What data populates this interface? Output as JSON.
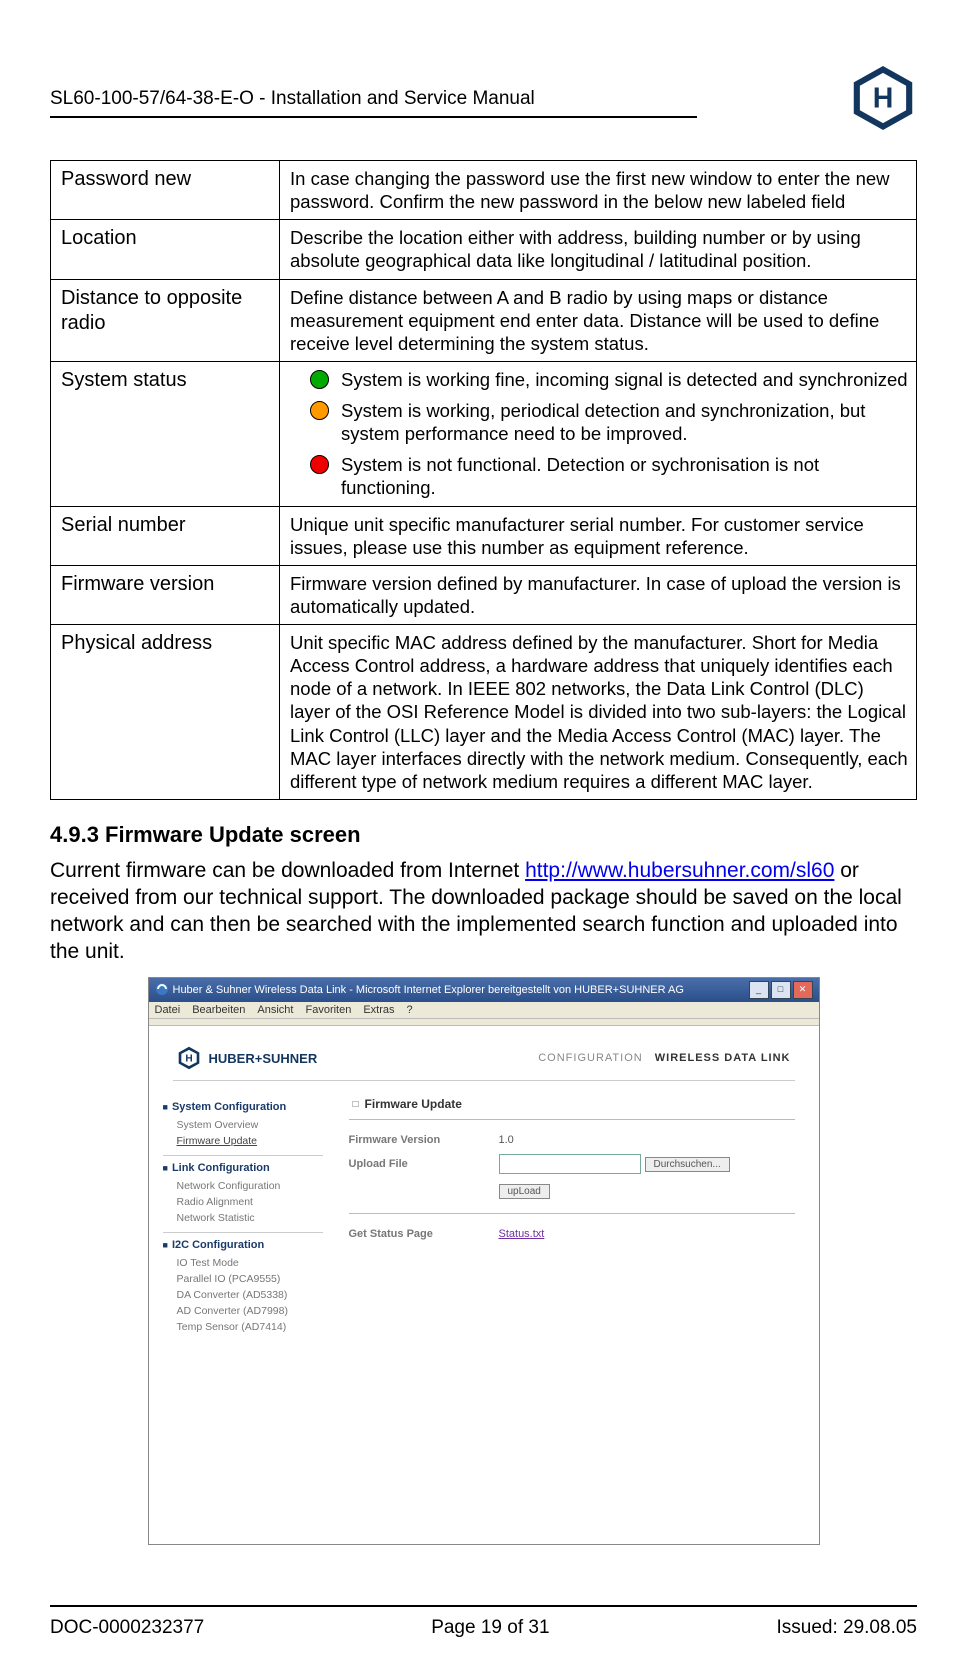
{
  "header": {
    "doc_title": "SL60-100-57/64-38-E-O  -  Installation and Service Manual"
  },
  "table": {
    "rows": [
      {
        "term": "Password new",
        "desc": "In case changing the password use the first new window to enter the new password. Confirm the new password in the below new labeled field"
      },
      {
        "term": "Location",
        "desc": "Describe the location either with address, building number or by using absolute geographical data like longitudinal / latitudinal position."
      },
      {
        "term": "Distance to opposite radio",
        "desc": "Define distance between A and B radio by using maps or distance measurement equipment end enter data. Distance will be used to define receive level determining the system status."
      },
      {
        "term": "System status",
        "status": [
          {
            "color": "green",
            "text": "System is working fine, incoming signal is detected and synchronized"
          },
          {
            "color": "orange",
            "text": "System is working, periodical detection and synchronization, but system performance need to be improved."
          },
          {
            "color": "red",
            "text": "System is not functional. Detection or sychronisation is not functioning."
          }
        ]
      },
      {
        "term": "Serial number",
        "desc": "Unique unit specific manufacturer serial number. For customer service issues, please use this number as equipment reference."
      },
      {
        "term": "Firmware version",
        "desc": "Firmware version defined by manufacturer. In case of upload the version is automatically updated."
      },
      {
        "term": "Physical address",
        "desc": "Unit specific MAC address defined by the manufacturer. Short for Media Access Control address, a hardware address that uniquely identifies each node of a network. In IEEE 802 networks, the Data Link Control (DLC) layer of the OSI Reference Model is divided into two sub-layers: the Logical Link Control (LLC) layer and the Media Access Control (MAC) layer. The MAC layer interfaces directly with the network medium. Consequently, each different type of network medium requires a different MAC layer."
      }
    ]
  },
  "section": {
    "heading": "4.9.3  Firmware Update screen",
    "para_pre": "Current firmware can be downloaded from Internet ",
    "link_text": "http://www.hubersuhner.com/sl60",
    "para_post": " or received from our technical support. The downloaded package should be saved on the local network and can then be searched with the implemented search function and uploaded into the unit."
  },
  "browser": {
    "title": "Huber & Suhner Wireless Data Link - Microsoft Internet Explorer bereitgestellt von HUBER+SUHNER AG",
    "menu": [
      "Datei",
      "Bearbeiten",
      "Ansicht",
      "Favoriten",
      "Extras",
      "?"
    ],
    "brand": "HUBER+SUHNER",
    "kv_label": "CONFIGURATION",
    "kv_value": "WIRELESS DATA LINK",
    "sidebar": {
      "g1_title": "System Configuration",
      "g1_items": [
        "System Overview",
        "Firmware Update"
      ],
      "g2_title": "Link Configuration",
      "g2_items": [
        "Network Configuration",
        "Radio Alignment",
        "Network Statistic"
      ],
      "g3_title": "I2C Configuration",
      "g3_items": [
        "IO Test Mode",
        "Parallel IO (PCA9555)",
        "DA Converter (AD5338)",
        "AD Converter (AD7998)",
        "Temp Sensor (AD7414)"
      ]
    },
    "panel": {
      "title": "Firmware Update",
      "fw_label": "Firmware Version",
      "fw_value": "1.0",
      "upload_label": "Upload File",
      "browse_btn": "Durchsuchen...",
      "upload_btn": "upLoad",
      "status_label": "Get Status Page",
      "status_link": "Status.txt"
    }
  },
  "footer": {
    "doc_id": "DOC-0000232377",
    "page": "Page 19 of 31",
    "issued": "Issued: 29.08.05"
  }
}
